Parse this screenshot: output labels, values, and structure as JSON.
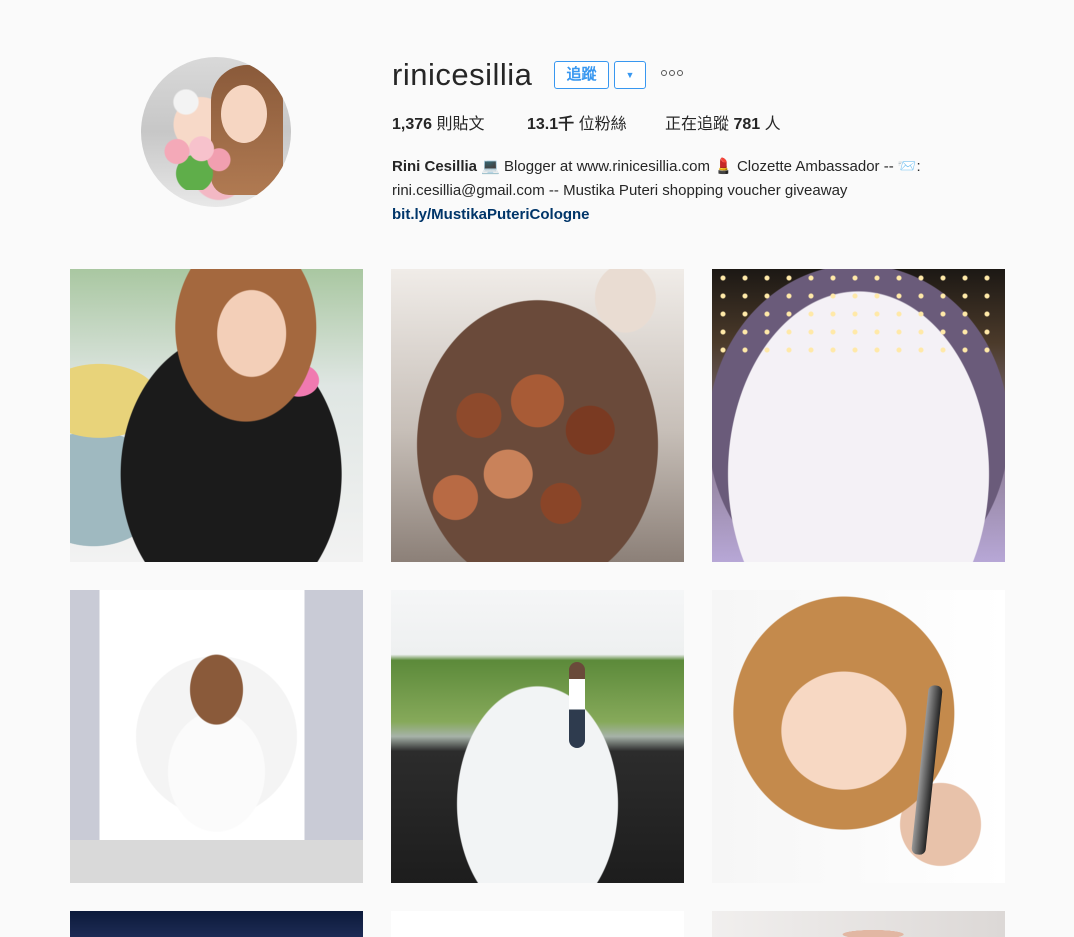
{
  "profile": {
    "username": "rinicesillia",
    "follow_label": "追蹤",
    "dropdown_label": "▼"
  },
  "stats": {
    "posts_count": "1,376",
    "posts_label": "則貼文",
    "followers_count": "13.1千",
    "followers_label": "位粉絲",
    "following_prefix": "正在追蹤",
    "following_count": "781",
    "following_suffix": "人"
  },
  "bio": {
    "name": "Rini Cesillia",
    "line1_rest": "💻 Blogger at www.rinicesillia.com 💄 Clozette Ambassador -- 📨:",
    "line2": "rini.cesillia@gmail.com -- Mustika Puteri shopping voucher giveaway",
    "link": "bit.ly/MustikaPuteriCologne"
  },
  "posts": [
    {
      "icon": "photo-woman-holding-pink-bottle"
    },
    {
      "icon": "photo-crispy-pork-bites"
    },
    {
      "icon": "photo-group-night-party"
    },
    {
      "icon": "photo-woman-on-swing-chair"
    },
    {
      "icon": "photo-woman-infinity-pool"
    },
    {
      "icon": "photo-woman-holding-mascara"
    },
    {
      "icon": "photo-partial-dark"
    },
    {
      "icon": "photo-partial-white"
    },
    {
      "icon": "photo-partial-woman"
    }
  ],
  "colors": {
    "accent": "#3897f0",
    "link": "#003569",
    "text": "#262626",
    "background": "#fafafa"
  }
}
